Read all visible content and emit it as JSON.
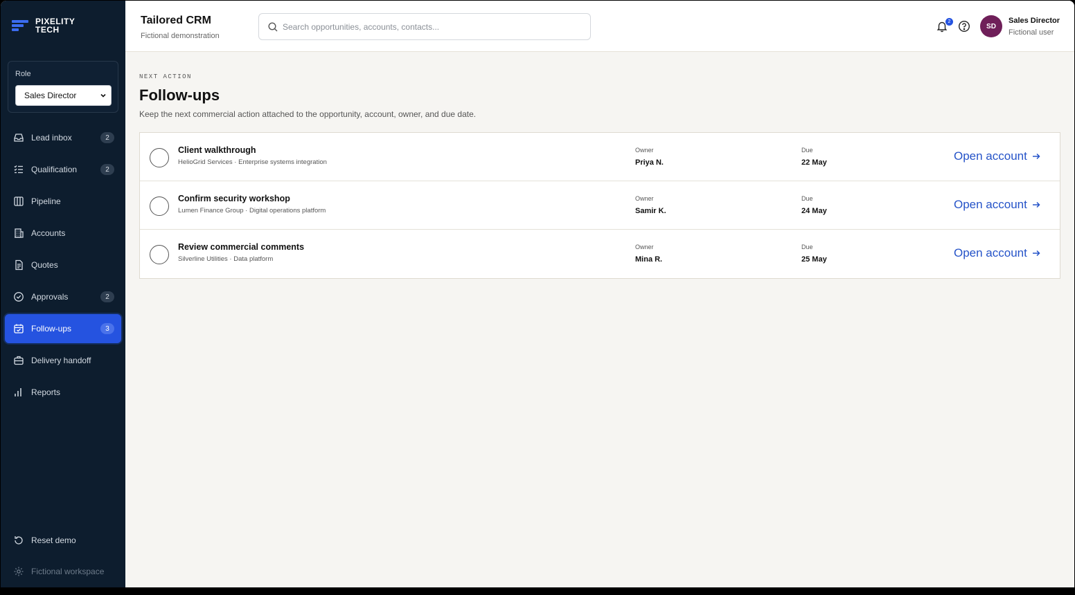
{
  "brand": {
    "line1": "PIXELITY",
    "line2": "TECH"
  },
  "role": {
    "label": "Role",
    "selected": "Sales Director"
  },
  "nav": [
    {
      "label": "Lead inbox",
      "badge": "2",
      "icon": "inbox-icon"
    },
    {
      "label": "Qualification",
      "badge": "2",
      "icon": "checklist-icon"
    },
    {
      "label": "Pipeline",
      "badge": "",
      "icon": "columns-icon"
    },
    {
      "label": "Accounts",
      "badge": "",
      "icon": "building-icon"
    },
    {
      "label": "Quotes",
      "badge": "",
      "icon": "document-icon"
    },
    {
      "label": "Approvals",
      "badge": "2",
      "icon": "check-circle-icon"
    },
    {
      "label": "Follow-ups",
      "badge": "3",
      "icon": "calendar-check-icon",
      "active": true
    },
    {
      "label": "Delivery handoff",
      "badge": "",
      "icon": "briefcase-icon"
    },
    {
      "label": "Reports",
      "badge": "",
      "icon": "bar-chart-icon"
    }
  ],
  "footer": {
    "reset": "Reset demo",
    "workspace": "Fictional workspace"
  },
  "header": {
    "title": "Tailored CRM",
    "subtitle": "Fictional demonstration",
    "search_placeholder": "Search opportunities, accounts, contacts...",
    "notification_count": "2",
    "avatar_initials": "SD",
    "user_name": "Sales Director",
    "user_sub": "Fictional user"
  },
  "page": {
    "eyebrow": "NEXT ACTION",
    "title": "Follow-ups",
    "description": "Keep the next commercial action attached to the opportunity, account, owner, and due date."
  },
  "labels": {
    "owner": "Owner",
    "due": "Due",
    "open": "Open account"
  },
  "followups": [
    {
      "title": "Client walkthrough",
      "sub": "HelioGrid Services · Enterprise systems integration",
      "owner": "Priya N.",
      "due": "22 May"
    },
    {
      "title": "Confirm security workshop",
      "sub": "Lumen Finance Group · Digital operations platform",
      "owner": "Samir K.",
      "due": "24 May"
    },
    {
      "title": "Review commercial comments",
      "sub": "Silverline Utilities · Data platform",
      "owner": "Mina R.",
      "due": "25 May"
    }
  ],
  "colors": {
    "sidebar": "#0d1d2e",
    "accent": "#2553e0",
    "link": "#2553c8",
    "avatar": "#6f1f59",
    "background": "#f6f5f2"
  }
}
